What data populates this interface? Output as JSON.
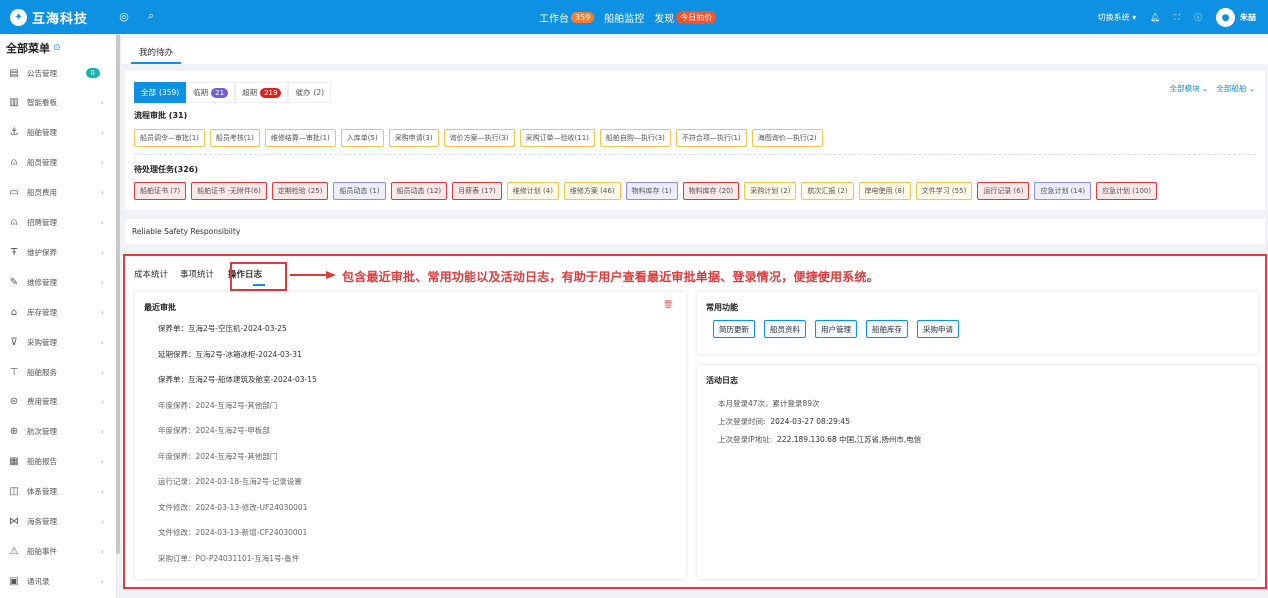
{
  "app": {
    "name": "互海科技",
    "logo_icon": "logo-icon"
  },
  "topbar": {
    "nav": [
      {
        "label": "工作台",
        "badge": "359"
      },
      {
        "label": "船舶监控"
      },
      {
        "label": "发现",
        "badge": "今日抽价"
      }
    ],
    "switch_system": "切换系统",
    "user": "朱喆",
    "colors": {
      "bar": "#0e90e3",
      "badge": "#f0812f",
      "badge_alt": "#f5532e"
    }
  },
  "sidebar": {
    "title": "全部菜单",
    "items": [
      {
        "label": "公告管理",
        "icon": "notice-icon",
        "badge": "0"
      },
      {
        "label": "智能看板",
        "icon": "chart-icon"
      },
      {
        "label": "船舶管理",
        "icon": "anchor-icon"
      },
      {
        "label": "船员管理",
        "icon": "person-icon"
      },
      {
        "label": "船员费用",
        "icon": "card-icon"
      },
      {
        "label": "招聘管理",
        "icon": "recruit-icon"
      },
      {
        "label": "维护保养",
        "icon": "tool-icon"
      },
      {
        "label": "维修管理",
        "icon": "wrench-icon"
      },
      {
        "label": "库存管理",
        "icon": "warehouse-icon"
      },
      {
        "label": "采购管理",
        "icon": "cart-icon"
      },
      {
        "label": "船舶服务",
        "icon": "service-icon"
      },
      {
        "label": "费用管理",
        "icon": "coin-icon"
      },
      {
        "label": "航次管理",
        "icon": "globe-icon"
      },
      {
        "label": "船舶报告",
        "icon": "report-icon"
      },
      {
        "label": "体系管理",
        "icon": "system-icon"
      },
      {
        "label": "海务管理",
        "icon": "sea-icon"
      },
      {
        "label": "船舶事件",
        "icon": "warning-icon"
      },
      {
        "label": "通讯录",
        "icon": "contacts-icon"
      }
    ]
  },
  "main_tab": "我的待办",
  "filters": [
    {
      "label": "全部",
      "count": "(359)",
      "active": true
    },
    {
      "label": "临期",
      "count": "21",
      "color": "#6e5fd6"
    },
    {
      "label": "超期",
      "count": "219",
      "color": "#e11f1f"
    },
    {
      "label": "催办",
      "count": "(2)"
    }
  ],
  "right_links": [
    "全部模块",
    "全部船舶"
  ],
  "flow_title": "流程审批 (31)",
  "flow_chips": [
    "船员调令—审批(1)",
    "船员考核(1)",
    "维修结算—审批(1)",
    "入库单(5)",
    "采购申请(3)",
    "询价方案—执行(3)",
    "采购订单—验收(11)",
    "船舶自购—执行(3)",
    "不符合项—执行(1)",
    "海图询价—执行(2)"
  ],
  "pending_title": "待处理任务(326)",
  "pending_chips": [
    {
      "label": "船舶证书 (7)",
      "style": "r"
    },
    {
      "label": "船舶证书 -无附件(6)",
      "style": "r"
    },
    {
      "label": "定期检验 (25)",
      "style": "r"
    },
    {
      "label": "船员动态 (1)",
      "style": "b"
    },
    {
      "label": "船员动态 (12)",
      "style": "r"
    },
    {
      "label": "月薪表 (17)",
      "style": "r"
    },
    {
      "label": "维修计划 (4)",
      "style": "y"
    },
    {
      "label": "维修方案 (46)",
      "style": "y"
    },
    {
      "label": "物料库存 (1)",
      "style": "b"
    },
    {
      "label": "物料库存 (20)",
      "style": "r"
    },
    {
      "label": "采购计划 (2)",
      "style": "y"
    },
    {
      "label": "航次汇报 (2)",
      "style": "y"
    },
    {
      "label": "岸电使用 (8)",
      "style": "y"
    },
    {
      "label": "文件学习 (55)",
      "style": "y"
    },
    {
      "label": "运行记录 (6)",
      "style": "r"
    },
    {
      "label": "应急计划 (14)",
      "style": "b"
    },
    {
      "label": "应急计划 (100)",
      "style": "r"
    }
  ],
  "slogan": "Reliable Safety Responsibilty",
  "lower_tabs": [
    "成本统计",
    "事项统计",
    "操作日志"
  ],
  "annotation": "包含最近审批、常用功能以及活动日志，有助于用户查看最近审批单据、登录情况，便捷使用系统。",
  "recent": {
    "title": "最近审批",
    "items": [
      {
        "text": "保养单：互海2号-空压机-2024-03-25",
        "dark": true
      },
      {
        "text": "延期保养：互海2号-冰箱冰柜-2024-03-31",
        "dark": true
      },
      {
        "text": "保养单：互海2号-船体建筑及舱室-2024-03-15",
        "dark": true
      },
      {
        "text": "年度保养：2024-互海2号-其他部门"
      },
      {
        "text": "年度保养：2024-互海2号-甲板部"
      },
      {
        "text": "年度保养：2024-互海2号-其他部门"
      },
      {
        "text": "运行记录：2024-03-18-互海2号-记录设置"
      },
      {
        "text": "文件修改：2024-03-13-修改-UF24030001"
      },
      {
        "text": "文件修改：2024-03-13-新增-CF24030001"
      },
      {
        "text": "采购订单：PO-P24031101-互海1号-备件"
      }
    ]
  },
  "common": {
    "title": "常用功能",
    "buttons": [
      "简历更新",
      "船员资料",
      "用户管理",
      "船舶库存",
      "采购申请"
    ]
  },
  "activity": {
    "title": "活动日志",
    "monthly": "本月登录47次，累计登录89次",
    "last_time_label": "上次登录时间:",
    "last_time": "2024-03-27 08:29:45",
    "last_ip_label": "上次登录IP地址:",
    "last_ip": "222.189.130.68 中国,江苏省,扬州市,电信"
  }
}
